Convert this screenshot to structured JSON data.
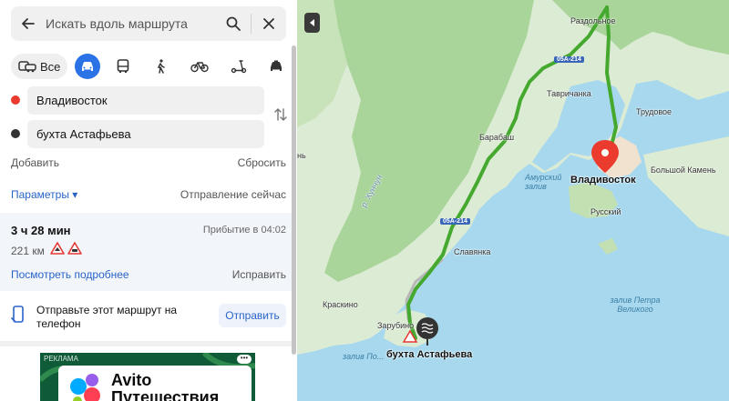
{
  "search": {
    "placeholder": "Искать вдоль маршрута"
  },
  "modes": {
    "all_label": "Все"
  },
  "route_points": {
    "from": "Владивосток",
    "to": "бухта Астафьева"
  },
  "actions": {
    "add": "Добавить",
    "reset": "Сбросить"
  },
  "params": {
    "label": "Параметры ▾",
    "departure": "Отправление сейчас"
  },
  "route": {
    "duration": "3 ч 28 мин",
    "arrival": "Прибытие в 04:02",
    "distance": "221 км",
    "details_link": "Посмотреть подробнее",
    "fix_link": "Исправить"
  },
  "send": {
    "text": "Отправьте этот маршрут на телефон",
    "button": "Отправить"
  },
  "ad": {
    "tag": "РЕКЛАМА",
    "brand_line1": "Avito",
    "brand_line2": "Путешествия"
  },
  "map": {
    "labels": {
      "razdolnoe": "Раздольное",
      "road_top": "05А-214",
      "tavrichanka": "Тавричанка",
      "trudovoe": "Трудовое",
      "barabash": "Барабаш",
      "amur_bay": "Амурский залив",
      "vladivostok": "Владивосток",
      "bolshoy_kamen": "Большой Камень",
      "russky": "Русский",
      "road_mid": "05А-214",
      "slavyanka": "Славянка",
      "kraskino": "Краскино",
      "peter_gulf": "залив Петра Великого",
      "zarubino": "Зарубино",
      "dest": "бухта Астафьева",
      "posiet_gulf": "залив По...",
      "river": "р. Хунчун",
      "left_edge": "нь"
    }
  }
}
